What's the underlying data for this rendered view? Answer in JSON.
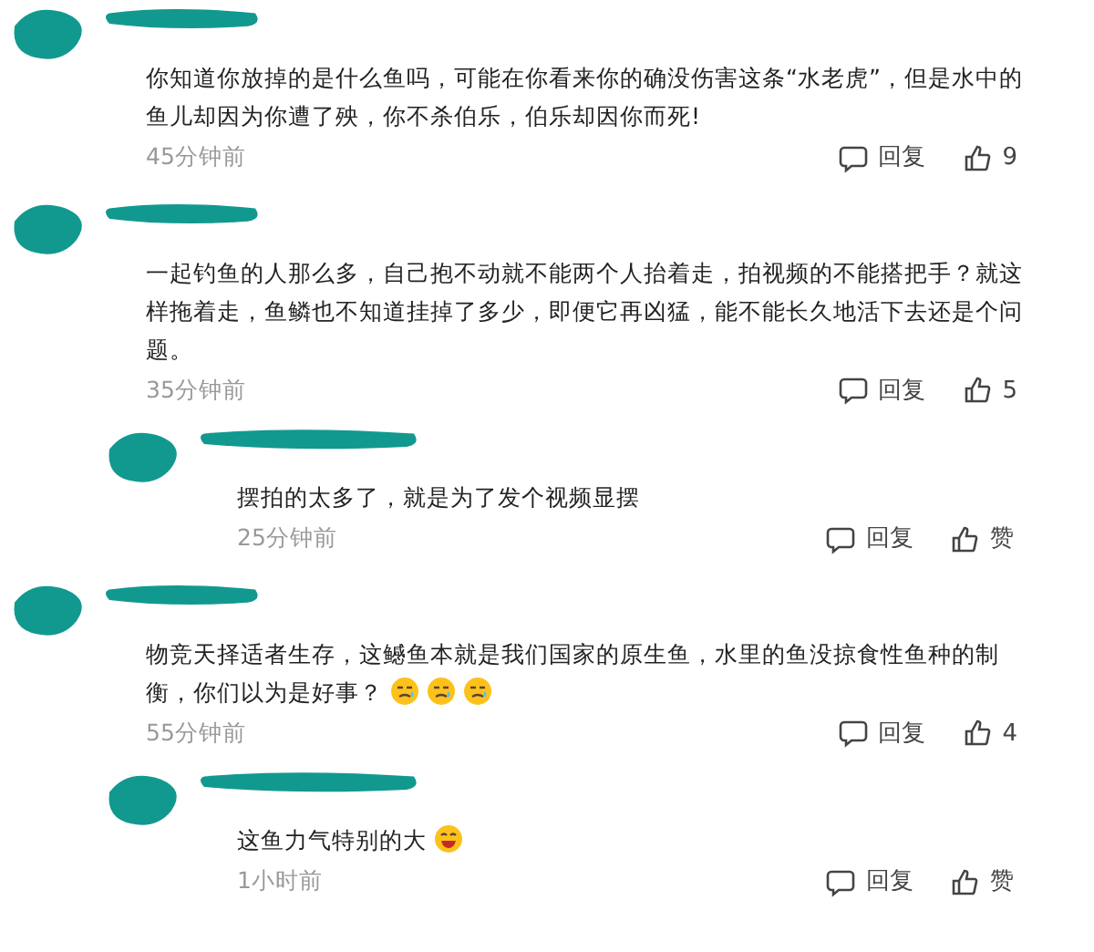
{
  "comments": [
    {
      "text": "你知道你放掉的是什么鱼吗，可能在你看来你的确没伤害这条“水老虎”，但是水中的鱼儿却因为你遭了殃，你不杀伯乐，伯乐却因你而死!",
      "time": "45分钟前",
      "reply_label": "回复",
      "likes": "9"
    },
    {
      "text": "一起钓鱼的人那么多，自己抱不动就不能两个人抬着走，拍视频的不能搭把手？就这样拖着走，鱼鳞也不知道挂掉了多少，即便它再凶猛，能不能长久地活下去还是个问题。",
      "time": "35分钟前",
      "reply_label": "回复",
      "likes": "5",
      "replies": [
        {
          "text": "摆拍的太多了，就是为了发个视频显摆",
          "time": "25分钟前",
          "reply_label": "回复",
          "likes": "赞"
        }
      ]
    },
    {
      "text": "物竞天择适者生存，这鳡鱼本就是我们国家的原生鱼，水里的鱼没掠食性鱼种的制衡，你们以为是好事？",
      "emojis": [
        {
          "kind": "sweat"
        },
        {
          "kind": "sweat"
        },
        {
          "kind": "sweat"
        }
      ],
      "time": "55分钟前",
      "reply_label": "回复",
      "likes": "4",
      "replies": [
        {
          "text": "这鱼力气特别的大",
          "emojis": [
            {
              "kind": "laugh"
            }
          ],
          "time": "1小时前",
          "reply_label": "回复",
          "likes": "赞"
        }
      ]
    }
  ]
}
